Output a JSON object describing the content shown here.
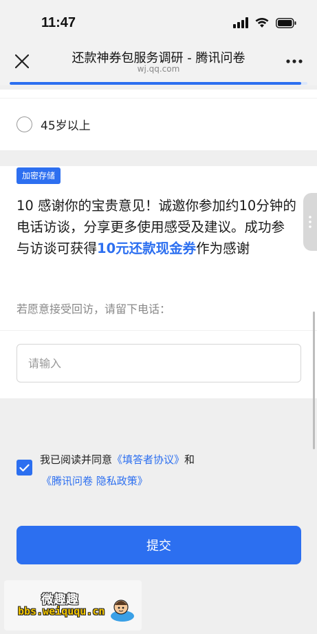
{
  "status_bar": {
    "time": "11:47"
  },
  "nav": {
    "title": "还款神券包服务调研 - 腾讯问卷",
    "subtitle": "wj.qq.com"
  },
  "progress": {
    "fraction": 0.98
  },
  "option": {
    "label": "45岁以上"
  },
  "question": {
    "badge": "加密存储",
    "text_before": "10  感谢你的宝贵意见！诚邀你参加约10分钟的电话访谈，分享更多使用感受及建议。成功参与访谈可获得",
    "highlight": "10元还款现金券",
    "text_after": "作为感谢",
    "hint": "若愿意接受回访，请留下电话：",
    "input_placeholder": "请输入",
    "input_value": ""
  },
  "agreement": {
    "checked": true,
    "prefix": "我已阅读并同意",
    "link1": "《填答者协议》",
    "middle": "和",
    "link2": "《腾讯问卷 隐私政策》"
  },
  "submit": {
    "label": "提交"
  },
  "watermark": {
    "title": "微趣趣",
    "url": "bbs.weiququ.cn"
  },
  "colors": {
    "accent": "#2c6ff0",
    "background": "#efefef"
  }
}
